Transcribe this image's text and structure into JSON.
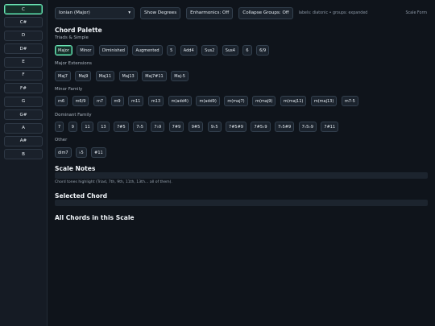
{
  "sidebar": {
    "keys": [
      "C",
      "C#",
      "D",
      "D#",
      "E",
      "F",
      "F#",
      "G",
      "G#",
      "A",
      "A#",
      "B"
    ]
  },
  "topbar": {
    "scale_select": "Ionian (Major)",
    "show_degrees": "Show Degrees",
    "enharmonics": "Enharmonics: Off",
    "collapse_groups": "Collapse Groups: Off",
    "labels_hint": "labels: diatonic • groups: expanded",
    "scale_form": "Scale Form"
  },
  "palette": {
    "title": "Chord Palette",
    "groups": [
      {
        "label": "Triads & Simple",
        "chips": [
          "Major",
          "Minor",
          "Diminished",
          "Augmented",
          "5",
          "Add4",
          "Sus2",
          "Sus4",
          "6",
          "6/9"
        ]
      },
      {
        "label": "Major Extensions",
        "chips": [
          "Maj7",
          "Maj9",
          "Maj11",
          "Maj13",
          "Maj7#11",
          "Maj-5"
        ]
      },
      {
        "label": "Minor Family",
        "chips": [
          "m6",
          "m6/9",
          "m7",
          "m9",
          "m11",
          "m13",
          "m(add4)",
          "m(add9)",
          "m(maj7)",
          "m(maj9)",
          "m(maj11)",
          "m(maj13)",
          "m7-5"
        ]
      },
      {
        "label": "Dominant Family",
        "chips": [
          "7",
          "9",
          "11",
          "13",
          "7#5",
          "7♭5",
          "7♭9",
          "7#9",
          "9#5",
          "9♭5",
          "7#5#9",
          "7#5♭9",
          "7♭5#9",
          "7♭5♭9",
          "7#11"
        ]
      },
      {
        "label": "Other",
        "chips": [
          "dim7",
          "♭5",
          "#11"
        ]
      }
    ]
  },
  "scale_notes": {
    "title": "Scale Notes",
    "hint": "Chord tones highlight (Triad, 7th, 9th, 11th, 13th… all of them)."
  },
  "selected_chord": {
    "title": "Selected Chord"
  },
  "all_chords": {
    "title": "All Chords in this Scale"
  }
}
